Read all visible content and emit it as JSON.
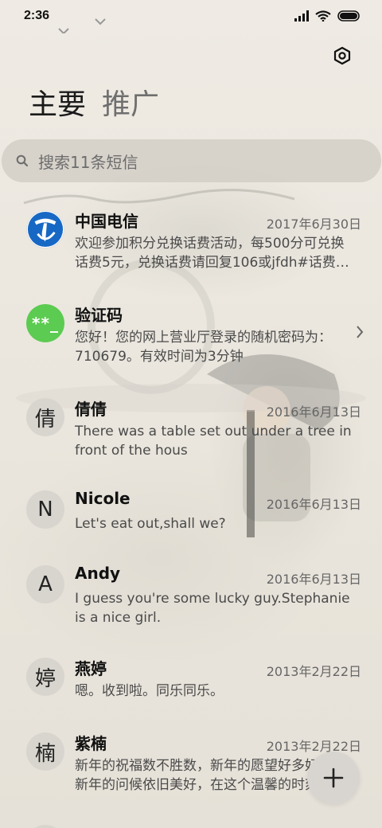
{
  "status_bar": {
    "time": "2:36"
  },
  "tabs": [
    {
      "label": "主要",
      "active": true
    },
    {
      "label": "推广",
      "active": false
    }
  ],
  "search": {
    "placeholder": "搜索11条短信"
  },
  "messages": [
    {
      "avatar_text": "",
      "avatar_icon": "china-telecom-logo",
      "sender": "中国电信",
      "date": "2017年6月30日",
      "preview": "欢迎参加积分兑换话费活动，每500分可兑换话费5元，兑换话费请回复106或jfdh#话费…"
    },
    {
      "avatar_text": "**_",
      "sender": "验证码",
      "date": "",
      "preview": "您好！您的网上营业厅登录的随机密码为：710679。有效时间为3分钟"
    },
    {
      "avatar_text": "倩",
      "sender": "倩倩",
      "date": "2016年6月13日",
      "preview": "There was a table set out under a tree in front of the hous"
    },
    {
      "avatar_text": "N",
      "sender": "Nicole",
      "date": "2016年6月13日",
      "preview": "Let's eat out,shall we?"
    },
    {
      "avatar_text": "A",
      "sender": "Andy",
      "date": "2016年6月13日",
      "preview": "I guess you're some lucky guy.Stephanie is a nice girl."
    },
    {
      "avatar_text": "婷",
      "sender": "燕婷",
      "date": "2013年2月22日",
      "preview": "嗯。收到啦。同乐同乐。"
    },
    {
      "avatar_text": "楠",
      "sender": "紫楠",
      "date": "2013年2月22日",
      "preview": "新年的祝福数不胜数，新年的愿望好多好多，新年的问候依旧美好，在这个温馨的时刻"
    }
  ],
  "icons": {
    "settings": "gear-icon",
    "search": "search-icon",
    "fab": "plus-icon",
    "chevron": "chevron-right-icon"
  },
  "colors": {
    "verify_avatar": "#5ccb51",
    "telecom_blue": "#1768c4"
  }
}
